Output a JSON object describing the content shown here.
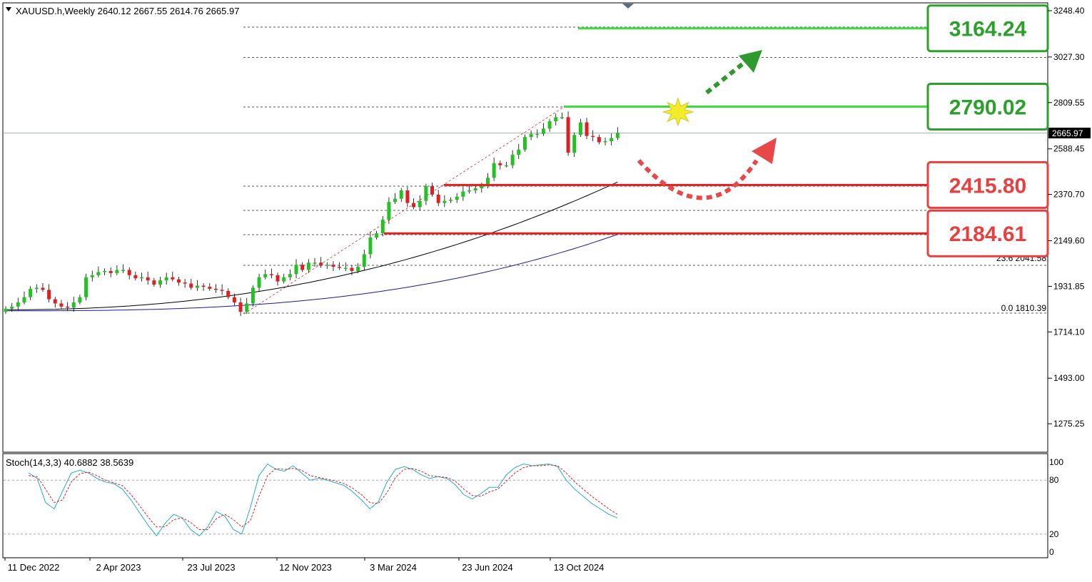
{
  "header": {
    "symbol_line": "XAUUSD.h,Weekly  2640.12 2667.55 2614.76 2665.97"
  },
  "current_price_tag": "2665.97",
  "price_axis_ticks": [
    "3248.40",
    "3027.30",
    "2809.55",
    "2588.45",
    "2370.70",
    "2149.60",
    "1931.85",
    "1714.10",
    "1493.00",
    "1275.25"
  ],
  "time_axis_ticks": [
    "11 Dec 2022",
    "2 Apr 2023",
    "23 Jul 2023",
    "12 Nov 2023",
    "3 Mar 2024",
    "23 Jun 2024",
    "13 Oct 2024"
  ],
  "fibonacci_labels": [
    "23.6 2041.58",
    "0.0 1810.39"
  ],
  "level_boxes": [
    {
      "label": "3164.24",
      "color": "#2ca02c"
    },
    {
      "label": "2790.02",
      "color": "#2ca02c"
    },
    {
      "label": "2415.80",
      "color": "#e84040"
    },
    {
      "label": "2184.61",
      "color": "#e84040"
    }
  ],
  "stochastic": {
    "label": "Stoch(14,3,3) 40.6882 38.5639",
    "ticks": [
      "100",
      "80",
      "20",
      "0"
    ]
  },
  "colors": {
    "bull_candle": "#22c222",
    "bear_candle": "#e02020",
    "ma_fast": "#000000",
    "ma_slow": "#1a1a9c",
    "stoch_main": "#20b0c8",
    "stoch_signal": "#e02020",
    "support_line": "#e52020",
    "resistance_line": "#3ddc3d"
  },
  "chart_data": {
    "type": "candlestick",
    "timeframe": "Weekly",
    "ylim": [
      1100,
      3300
    ],
    "levels": {
      "resistance": [
        3164.24,
        2790.02
      ],
      "support": [
        2415.8,
        2184.61
      ]
    },
    "fibonacci": [
      {
        "level": "23.6",
        "price": 2041.58
      },
      {
        "level": "0.0",
        "price": 1810.39
      }
    ],
    "close_series": [
      1825,
      1835,
      1855,
      1880,
      1920,
      1925,
      1915,
      1870,
      1850,
      1835,
      1830,
      1855,
      1880,
      1975,
      1985,
      2000,
      2005,
      1995,
      2010,
      2010,
      1985,
      1970,
      1975,
      1960,
      1940,
      1960,
      1975,
      1965,
      1950,
      1945,
      1925,
      1935,
      1930,
      1920,
      1915,
      1910,
      1880,
      1855,
      1810,
      1850,
      1925,
      1975,
      1990,
      1985,
      1955,
      1975,
      1990,
      2035,
      2010,
      2045,
      2045,
      2030,
      2035,
      2025,
      2020,
      2020,
      2005,
      2025,
      2085,
      2165,
      2185,
      2250,
      2335,
      2350,
      2390,
      2330,
      2310,
      2340,
      2410,
      2370,
      2330,
      2340,
      2345,
      2360,
      2385,
      2390,
      2400,
      2410,
      2450,
      2520,
      2510,
      2510,
      2560,
      2585,
      2645,
      2660,
      2660,
      2685,
      2720,
      2740,
      2740,
      2570,
      2655,
      2715,
      2650,
      2645,
      2620,
      2625,
      2640,
      2665
    ],
    "ma_fast_end": 2430,
    "ma_slow_end": 2180,
    "stochastic": {
      "main": [
        88,
        82,
        55,
        48,
        68,
        88,
        91,
        88,
        82,
        78,
        76,
        70,
        58,
        44,
        30,
        18,
        32,
        42,
        38,
        25,
        18,
        28,
        45,
        40,
        25,
        20,
        50,
        85,
        98,
        92,
        90,
        96,
        88,
        80,
        82,
        80,
        77,
        74,
        67,
        58,
        48,
        56,
        78,
        92,
        95,
        92,
        86,
        82,
        84,
        82,
        75,
        64,
        59,
        65,
        72,
        72,
        86,
        94,
        98,
        96,
        97,
        98,
        95,
        80,
        70,
        62,
        54,
        48,
        42,
        38
      ],
      "signal": [
        85,
        84,
        70,
        55,
        58,
        78,
        87,
        89,
        85,
        80,
        77,
        74,
        64,
        52,
        39,
        28,
        28,
        36,
        38,
        33,
        25,
        25,
        37,
        42,
        36,
        28,
        35,
        62,
        85,
        93,
        92,
        93,
        91,
        85,
        83,
        81,
        79,
        76,
        71,
        64,
        55,
        54,
        66,
        83,
        92,
        93,
        90,
        85,
        84,
        83,
        79,
        70,
        63,
        62,
        67,
        70,
        79,
        88,
        94,
        96,
        96,
        97,
        96,
        88,
        78,
        70,
        62,
        55,
        48,
        42
      ]
    }
  }
}
